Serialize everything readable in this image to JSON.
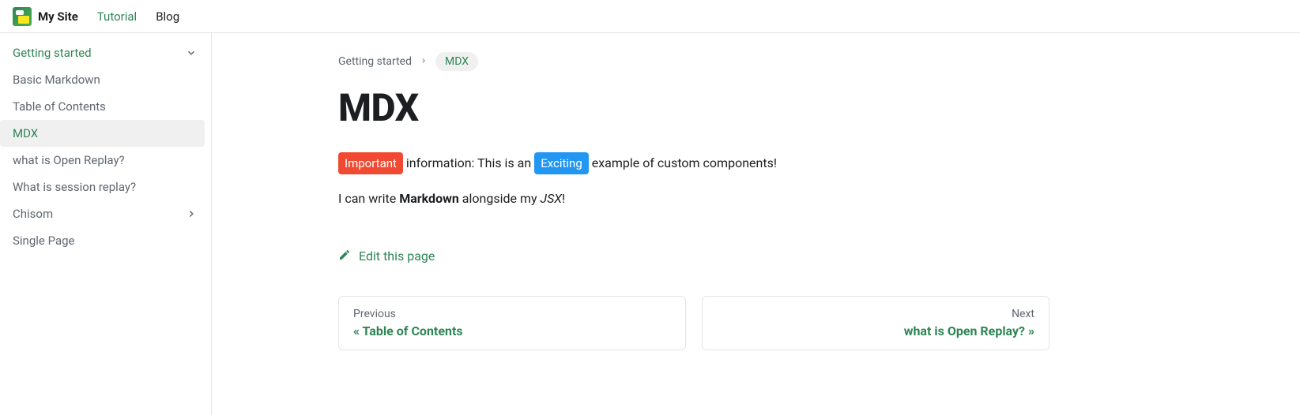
{
  "navbar": {
    "brand": "My Site",
    "links": [
      {
        "label": "Tutorial",
        "active": true
      },
      {
        "label": "Blog",
        "active": false
      }
    ]
  },
  "sidebar": {
    "sections": [
      {
        "label": "Getting started",
        "expanded": true,
        "items": [
          {
            "label": "Basic Markdown",
            "active": false
          },
          {
            "label": "Table of Contents",
            "active": false
          },
          {
            "label": "MDX",
            "active": true
          },
          {
            "label": "what is Open Replay?",
            "active": false
          },
          {
            "label": "What is session replay?",
            "active": false
          }
        ]
      },
      {
        "label": "Chisom",
        "expanded": false,
        "items": []
      },
      {
        "label": "Single Page",
        "expanded": null,
        "items": []
      }
    ]
  },
  "breadcrumb": {
    "parent": "Getting started",
    "current": "MDX"
  },
  "page": {
    "title": "MDX",
    "para1": {
      "badge1": "Important",
      "text1": " information: This is an ",
      "badge2": "Exciting",
      "text2": " example of custom components!"
    },
    "para2": {
      "text1": "I can write ",
      "bold": "Markdown",
      "text2": " alongside my ",
      "ital": "JSX",
      "text3": "!"
    },
    "edit_label": "Edit this page"
  },
  "pagenav": {
    "prev": {
      "label": "Previous",
      "title": "« Table of Contents"
    },
    "next": {
      "label": "Next",
      "title": "what is Open Replay? »"
    }
  }
}
